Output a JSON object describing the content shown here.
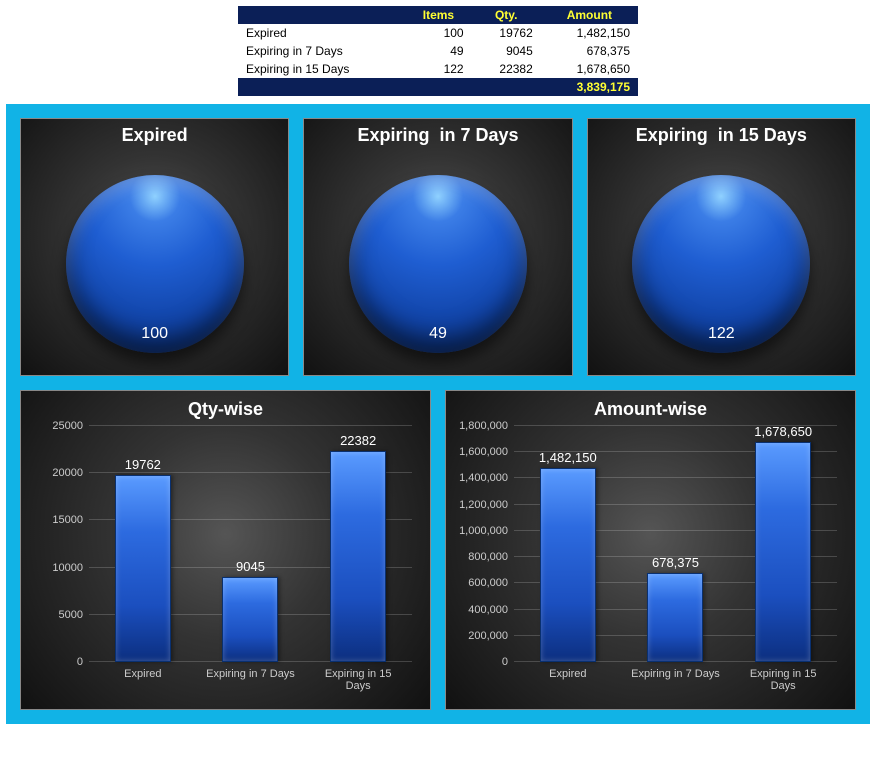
{
  "table": {
    "headers": [
      "",
      "Items",
      "Qty.",
      "Amount"
    ],
    "rows": [
      {
        "label": "Expired",
        "items": "100",
        "qty": "19762",
        "amount": "1,482,150"
      },
      {
        "label": "Expiring in 7 Days",
        "items": "49",
        "qty": "9045",
        "amount": "678,375"
      },
      {
        "label": "Expiring in 15 Days",
        "items": "122",
        "qty": "22382",
        "amount": "1,678,650"
      }
    ],
    "total": "3,839,175"
  },
  "pies": [
    {
      "title": "Expired",
      "value": "100"
    },
    {
      "title": "Expiring  in 7 Days",
      "value": "49"
    },
    {
      "title": "Expiring  in 15 Days",
      "value": "122"
    }
  ],
  "bars": {
    "qty": {
      "title": "Qty-wise",
      "ylim": 25000,
      "yticks": [
        "0",
        "5000",
        "10000",
        "15000",
        "20000",
        "25000"
      ],
      "items": [
        {
          "label": "Expired",
          "value": 19762,
          "display": "19762"
        },
        {
          "label": "Expiring in 7 Days",
          "value": 9045,
          "display": "9045"
        },
        {
          "label": "Expiring in 15 Days",
          "value": 22382,
          "display": "22382"
        }
      ]
    },
    "amount": {
      "title": "Amount-wise",
      "ylim": 1800000,
      "yticks": [
        "0",
        "200,000",
        "400,000",
        "600,000",
        "800,000",
        "1,000,000",
        "1,200,000",
        "1,400,000",
        "1,600,000",
        "1,800,000"
      ],
      "items": [
        {
          "label": "Expired",
          "value": 1482150,
          "display": "1,482,150"
        },
        {
          "label": "Expiring in 7 Days",
          "value": 678375,
          "display": "678,375"
        },
        {
          "label": "Expiring in 15\nDays",
          "value": 1678650,
          "display": "1,678,650"
        }
      ]
    }
  },
  "chart_data": [
    {
      "type": "pie",
      "title": "Expired",
      "categories": [
        "Expired"
      ],
      "values": [
        100
      ]
    },
    {
      "type": "pie",
      "title": "Expiring in 7 Days",
      "categories": [
        "Expiring in 7 Days"
      ],
      "values": [
        49
      ]
    },
    {
      "type": "pie",
      "title": "Expiring in 15 Days",
      "categories": [
        "Expiring in 15 Days"
      ],
      "values": [
        122
      ]
    },
    {
      "type": "bar",
      "title": "Qty-wise",
      "categories": [
        "Expired",
        "Expiring in 7 Days",
        "Expiring in 15 Days"
      ],
      "values": [
        19762,
        9045,
        22382
      ],
      "xlabel": "",
      "ylabel": "",
      "ylim": [
        0,
        25000
      ]
    },
    {
      "type": "bar",
      "title": "Amount-wise",
      "categories": [
        "Expired",
        "Expiring in 7 Days",
        "Expiring in 15 Days"
      ],
      "values": [
        1482150,
        678375,
        1678650
      ],
      "xlabel": "",
      "ylabel": "",
      "ylim": [
        0,
        1800000
      ]
    },
    {
      "type": "table",
      "title": "",
      "headers": [
        "",
        "Items",
        "Qty.",
        "Amount"
      ],
      "rows": [
        [
          "Expired",
          100,
          19762,
          1482150
        ],
        [
          "Expiring in 7 Days",
          49,
          9045,
          678375
        ],
        [
          "Expiring in 15 Days",
          122,
          22382,
          1678650
        ]
      ],
      "total_amount": 3839175
    }
  ]
}
